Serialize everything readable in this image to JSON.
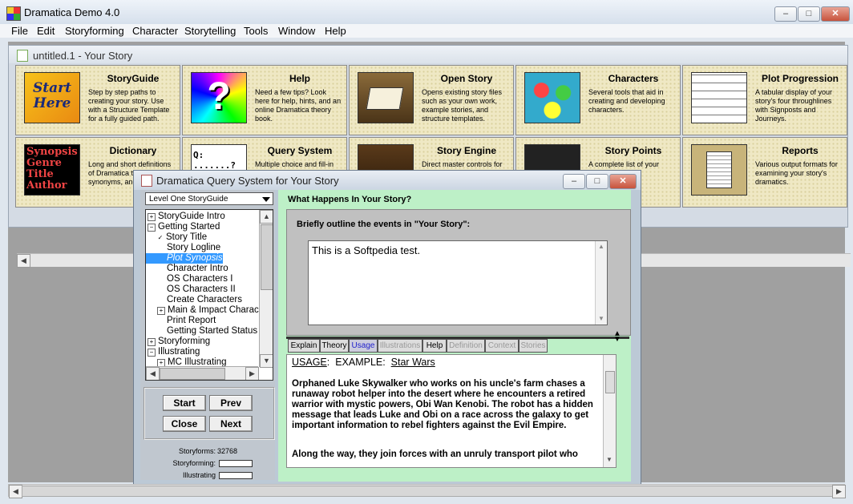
{
  "window": {
    "title": "Dramatica Demo 4.0",
    "buttons": {
      "minimize": "–",
      "maximize": "□",
      "close": "✕"
    }
  },
  "menu": [
    "File",
    "Edit",
    "Storyforming",
    "Character",
    "Storytelling",
    "Tools",
    "Window",
    "Help"
  ],
  "document": {
    "title": "untitled.1 - Your Story",
    "tiles": [
      {
        "title": "StoryGuide",
        "desc": "Step by step paths to creating your story. Use with a Structure Template for a fully guided path.",
        "thumb_text": "Start Here"
      },
      {
        "title": "Help",
        "desc": "Need a few tips? Look here for help, hints, and an online Dramatica theory book.",
        "thumb_text": "?"
      },
      {
        "title": "Open Story",
        "desc": "Opens existing story files such as your own work, example stories, and structure templates.",
        "thumb_text": ""
      },
      {
        "title": "Characters",
        "desc": "Several tools that aid in creating and developing characters.",
        "thumb_text": ""
      },
      {
        "title": "Plot Progression",
        "desc": "A tabular display of your story's four throughlines with Signposts and Journeys.",
        "thumb_text": ""
      },
      {
        "title": "Dictionary",
        "desc": "Long and short definitions of Dramatica terms, synonyms, and",
        "thumb_text": "Synopsis Genre Title Author"
      },
      {
        "title": "Query System",
        "desc": "Multiple choice and fill-in",
        "thumb_text": "Q: .......?"
      },
      {
        "title": "Story Engine",
        "desc": "Direct master controls for",
        "thumb_text": ""
      },
      {
        "title": "Story Points",
        "desc": "A complete list of your",
        "thumb_text": ""
      },
      {
        "title": "Reports",
        "desc": "Various output formats for examining your story's dramatics.",
        "thumb_text": ""
      }
    ]
  },
  "query": {
    "title": "Dramatica Query System for Your Story",
    "dropdown": "Level One StoryGuide",
    "tree": [
      {
        "label": "StoryGuide Intro",
        "toggle": "+",
        "indent": 0
      },
      {
        "label": "Getting Started",
        "toggle": "−",
        "indent": 0
      },
      {
        "label": "Story Title",
        "toggle": "✓",
        "indent": 1
      },
      {
        "label": "Story Logline",
        "toggle": "",
        "indent": 1
      },
      {
        "label": "Plot Synopsis",
        "toggle": "",
        "indent": 1
      },
      {
        "label": "Character Intro",
        "toggle": "",
        "indent": 1
      },
      {
        "label": "OS Characters I",
        "toggle": "",
        "indent": 1
      },
      {
        "label": "OS Characters II",
        "toggle": "",
        "indent": 1
      },
      {
        "label": "Create Characters",
        "toggle": "",
        "indent": 1
      },
      {
        "label": "Main & Impact Charac",
        "toggle": "+",
        "indent": 1
      },
      {
        "label": "Print Report",
        "toggle": "",
        "indent": 1
      },
      {
        "label": "Getting Started Status",
        "toggle": "",
        "indent": 1
      },
      {
        "label": "Storyforming",
        "toggle": "+",
        "indent": 0
      },
      {
        "label": "Illustrating",
        "toggle": "−",
        "indent": 0
      },
      {
        "label": "MC Illustrating",
        "toggle": "+",
        "indent": 1
      }
    ],
    "selected_index": 4,
    "buttons": {
      "start": "Start",
      "prev": "Prev",
      "close": "Close",
      "next": "Next"
    },
    "stats": {
      "storyforms_label": "Storyforms:",
      "storyforms_value": "32768",
      "storyforming_label": "Storyforming:",
      "illustrating_label": "Illustrating",
      "storyforming_progress": 0.0,
      "illustrating_progress": 0.0
    },
    "heading": "What Happens In Your Story?",
    "prompt": "Briefly outline the events in \"Your Story\":",
    "answer": "This is a Softpedia test.",
    "tabs": [
      "Explain",
      "Theory",
      "Usage",
      "Illustrations",
      "Help",
      "Definition",
      "Context",
      "Stories"
    ],
    "active_tab": "Usage",
    "usage": {
      "label": "USAGE",
      "example_label": "EXAMPLE:",
      "example_title": "Star Wars",
      "p1": "Orphaned Luke Skywalker who works on his uncle's farm chases a runaway robot helper into the desert where he encounters a retired warrior with mystic powers, Obi Wan Kenobi.  The robot has a hidden message that leads Luke and Obi on a race across the galaxy to get important information to rebel fighters against the Evil Empire.",
      "p2": "Along the way, they join forces with an unruly transport pilot who"
    }
  },
  "colors": {
    "tile_bg": "#efe8c4",
    "query_right_bg": "#bdf0c7",
    "selection": "#3399ff"
  }
}
